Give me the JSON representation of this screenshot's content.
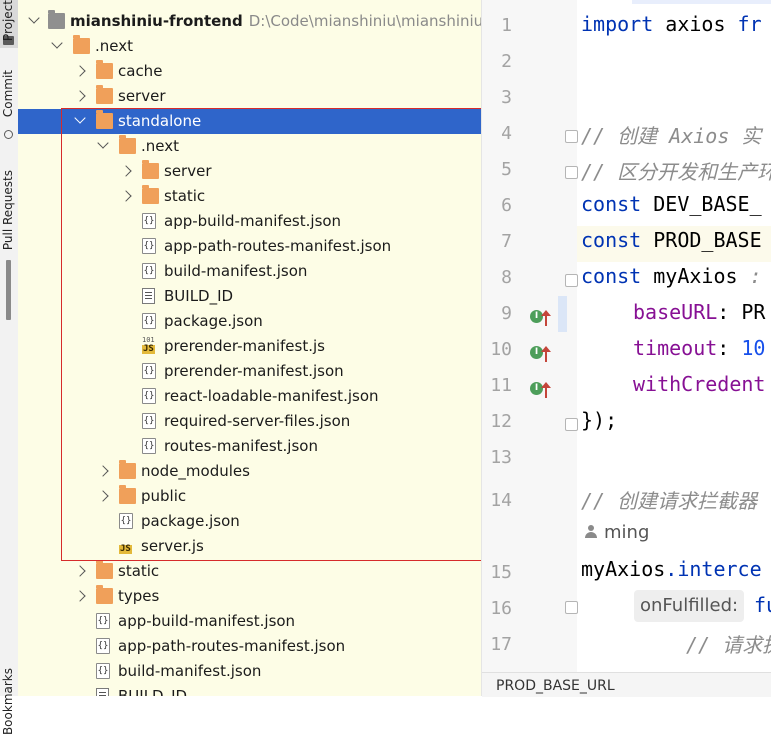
{
  "left_toolbar": {
    "tabs": [
      {
        "label": "Project"
      },
      {
        "label": "Commit"
      },
      {
        "label": "Pull Requests"
      },
      {
        "label": "Bookmarks"
      }
    ]
  },
  "project_tree": {
    "root": {
      "name": "mianshiniu-frontend",
      "path": "D:\\Code\\mianshiniu\\mianshiniu-fro"
    },
    "items": [
      {
        "name": ".next",
        "type": "folder",
        "depth": 1,
        "expanded": true
      },
      {
        "name": "cache",
        "type": "folder",
        "depth": 2,
        "expanded": false
      },
      {
        "name": "server",
        "type": "folder",
        "depth": 2,
        "expanded": false
      },
      {
        "name": "standalone",
        "type": "folder",
        "depth": 2,
        "expanded": true,
        "selected": true
      },
      {
        "name": ".next",
        "type": "folder",
        "depth": 3,
        "expanded": true
      },
      {
        "name": "server",
        "type": "folder",
        "depth": 4,
        "expanded": false
      },
      {
        "name": "static",
        "type": "folder",
        "depth": 4,
        "expanded": false
      },
      {
        "name": "app-build-manifest.json",
        "type": "json",
        "depth": 4
      },
      {
        "name": "app-path-routes-manifest.json",
        "type": "json",
        "depth": 4
      },
      {
        "name": "build-manifest.json",
        "type": "json",
        "depth": 4
      },
      {
        "name": "BUILD_ID",
        "type": "text",
        "depth": 4
      },
      {
        "name": "package.json",
        "type": "json",
        "depth": 4
      },
      {
        "name": "prerender-manifest.js",
        "type": "js101",
        "depth": 4
      },
      {
        "name": "prerender-manifest.json",
        "type": "json",
        "depth": 4
      },
      {
        "name": "react-loadable-manifest.json",
        "type": "json",
        "depth": 4
      },
      {
        "name": "required-server-files.json",
        "type": "json",
        "depth": 4
      },
      {
        "name": "routes-manifest.json",
        "type": "json",
        "depth": 4
      },
      {
        "name": "node_modules",
        "type": "folder",
        "depth": 3,
        "expanded": false
      },
      {
        "name": "public",
        "type": "folder",
        "depth": 3,
        "expanded": false
      },
      {
        "name": "package.json",
        "type": "json",
        "depth": 3
      },
      {
        "name": "server.js",
        "type": "js",
        "depth": 3
      },
      {
        "name": "static",
        "type": "folder",
        "depth": 2,
        "expanded": false
      },
      {
        "name": "types",
        "type": "folder",
        "depth": 2,
        "expanded": false
      },
      {
        "name": "app-build-manifest.json",
        "type": "json",
        "depth": 2
      },
      {
        "name": "app-path-routes-manifest.json",
        "type": "json",
        "depth": 2
      },
      {
        "name": "build-manifest.json",
        "type": "json",
        "depth": 2
      },
      {
        "name": "BUILD_ID",
        "type": "text",
        "depth": 2
      }
    ]
  },
  "editor": {
    "lines": [
      {
        "n": "1",
        "tokens": [
          {
            "t": "import ",
            "c": "kw"
          },
          {
            "t": "axios ",
            "c": "vrb"
          },
          {
            "t": "fr",
            "c": "kw"
          }
        ]
      },
      {
        "n": "2",
        "tokens": []
      },
      {
        "n": "3",
        "tokens": []
      },
      {
        "n": "4",
        "tokens": [
          {
            "t": "// 创建 Axios 实",
            "c": "cm"
          }
        ],
        "fold": true
      },
      {
        "n": "5",
        "tokens": [
          {
            "t": "// 区分开发和生产环",
            "c": "cm"
          }
        ],
        "fold": true
      },
      {
        "n": "6",
        "tokens": [
          {
            "t": "const ",
            "c": "kw"
          },
          {
            "t": "DEV_BASE_",
            "c": "vrb"
          }
        ]
      },
      {
        "n": "7",
        "tokens": [
          {
            "t": "const ",
            "c": "kw"
          },
          {
            "t": "PROD_BASE",
            "c": "vrb"
          }
        ]
      },
      {
        "n": "8",
        "tokens": [
          {
            "t": "const ",
            "c": "kw"
          },
          {
            "t": "myAxios",
            "c": "vrb"
          },
          {
            "t": " : ",
            "c": "cm"
          }
        ],
        "fold": true
      },
      {
        "n": "9",
        "tokens": [
          {
            "t": "baseURL",
            "c": "prop"
          },
          {
            "t": ": PR",
            "c": "vrb"
          }
        ],
        "impl": true
      },
      {
        "n": "10",
        "tokens": [
          {
            "t": "timeout",
            "c": "prop"
          },
          {
            "t": ": ",
            "c": "vrb"
          },
          {
            "t": "10",
            "c": "num"
          }
        ],
        "impl": true
      },
      {
        "n": "11",
        "tokens": [
          {
            "t": "withCredent",
            "c": "prop"
          }
        ],
        "impl": true
      },
      {
        "n": "12",
        "tokens": [
          {
            "t": "});",
            "c": "vrb"
          }
        ],
        "fold": true
      },
      {
        "n": "13",
        "tokens": []
      },
      {
        "n": "14",
        "tokens": [
          {
            "t": "// 创建请求拦截器",
            "c": "cm"
          }
        ]
      },
      {
        "n": "15",
        "tokens": [
          {
            "t": "myAxios",
            "c": "vrb"
          },
          {
            "t": ".interce",
            "c": "kw"
          }
        ]
      },
      {
        "n": "16",
        "tokens": [
          {
            "t": "fu",
            "c": "kw"
          }
        ],
        "fold": true
      },
      {
        "n": "17",
        "tokens": [
          {
            "t": "// 请求执",
            "c": "cm"
          }
        ]
      }
    ],
    "author": "ming",
    "inlay_hint": "onFulfilled:",
    "breadcrumb": "PROD_BASE_URL"
  }
}
